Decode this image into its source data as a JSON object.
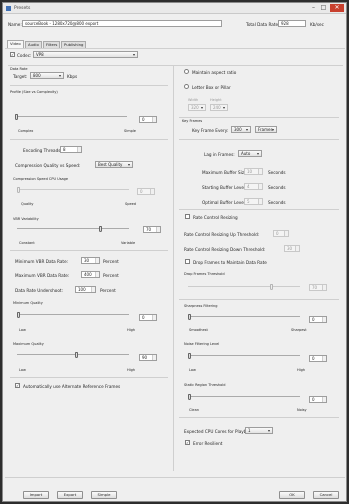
{
  "window": {
    "title": "Presets"
  },
  "header": {
    "name_label": "Name:",
    "name_value": "sourceBook - 1280x720@800 export",
    "total_rate_label": "Total Data Rate:",
    "total_rate_value": "928",
    "total_rate_unit": "Kb/sec"
  },
  "tabs": [
    "Video",
    "Audio",
    "Filters",
    "Publishing"
  ],
  "codec": {
    "label": "Codec:",
    "value": "VP8",
    "checked": true
  },
  "left": {
    "data_rate_label": "Data Rate",
    "target_label": "Target:",
    "target_value": "800",
    "target_unit": "Kbps",
    "profile_label": "Profile (Size vs Complexity)",
    "profile_value": "0",
    "profile_min": "Complex",
    "profile_max": "Simple",
    "threads_label": "Encoding Threads:",
    "threads_value": "8",
    "cq_label": "Compression Quality vs Speed:",
    "cq_value": "Best Quality",
    "cpu_label": "Compression Speed CPU Usage",
    "cpu_value": "0",
    "cpu_min": "Quality",
    "cpu_max": "Speed",
    "vbr_label": "VBR Variability",
    "vbr_value": "70",
    "vbr_min": "Constant",
    "vbr_max": "Variable",
    "min_vbr_label": "Minimum VBR Data Rate:",
    "min_vbr_value": "30",
    "min_vbr_unit": "Percent",
    "max_vbr_label": "Maximum VBR Data Rate:",
    "max_vbr_value": "400",
    "max_vbr_unit": "Percent",
    "undershoot_label": "Data Rate Undershoot:",
    "undershoot_value": "100",
    "undershoot_unit": "Percent",
    "minq_label": "Minimum Quality",
    "minq_value": "0",
    "minq_min": "Low",
    "minq_max": "High",
    "maxq_label": "Maximum Quality",
    "maxq_value": "90",
    "maxq_min": "Low",
    "maxq_max": "High",
    "altref_label": "Automatically use Alternate Reference Frames"
  },
  "right": {
    "aspect_label": "Maintain aspect ratio",
    "letterbox_label": "Letter Box or Pillar",
    "width_label": "Width",
    "width_value": "320",
    "height_label": "Height",
    "height_value": "240",
    "keyframes_label": "Key Frames",
    "kf_every_label": "Key Frame Every:",
    "kf_every_value": "300",
    "kf_unit": "Frames",
    "lag_label": "Lag in Frames:",
    "lag_value": "Auto",
    "max_buf_label": "Maximum Buffer Size:",
    "max_buf_value": "10",
    "buf_unit": "Seconds",
    "start_buf_label": "Starting Buffer Level:",
    "start_buf_value": "4",
    "opt_buf_label": "Optimal Buffer Level:",
    "opt_buf_value": "5",
    "rc_resize_label": "Rate Control Resizing",
    "rc_up_label": "Rate Control Resizing Up Threshold:",
    "rc_up_value": "0",
    "rc_down_label": "Rate Control Resizing Down Threshold:",
    "rc_down_value": "30",
    "drop_label": "Drop Frames to Maintain Data Rate",
    "drop_thresh_label": "Drop Frames Threshold",
    "drop_thresh_value": "70",
    "sharp_label": "Sharpness Filtering",
    "sharp_value": "0",
    "sharp_min": "Smoothest",
    "sharp_max": "Sharpest",
    "noise_label": "Noise Filtering Level",
    "noise_value": "0",
    "noise_min": "Low",
    "noise_max": "High",
    "static_label": "Static Region Threshold",
    "static_value": "0",
    "static_min": "Clean",
    "static_max": "Noisy",
    "cpu_cores_label": "Expected CPU Cores for Playback:",
    "cpu_cores_value": "1",
    "error_label": "Error Resilient"
  },
  "footer": {
    "import": "Import",
    "export": "Export",
    "simple": "Simple",
    "ok": "OK",
    "cancel": "Cancel"
  }
}
